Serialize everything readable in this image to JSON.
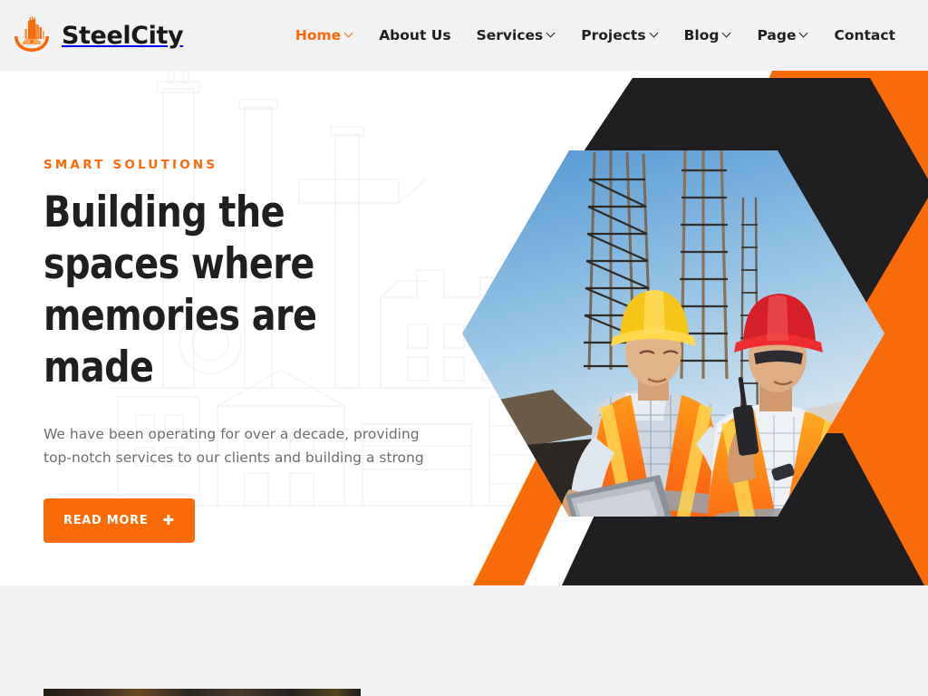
{
  "brand": {
    "name": "SteelCity",
    "logo_icon": "factory-skyline-icon",
    "accent_color": "#f96a09"
  },
  "nav": {
    "items": [
      {
        "label": "Home",
        "has_dropdown": true,
        "active": true,
        "icon": "chevron-down-icon"
      },
      {
        "label": "About Us",
        "has_dropdown": false,
        "active": false,
        "icon": ""
      },
      {
        "label": "Services",
        "has_dropdown": true,
        "active": false,
        "icon": "chevron-down-icon"
      },
      {
        "label": "Projects",
        "has_dropdown": true,
        "active": false,
        "icon": "chevron-down-icon"
      },
      {
        "label": "Blog",
        "has_dropdown": true,
        "active": false,
        "icon": "chevron-down-icon"
      },
      {
        "label": "Page",
        "has_dropdown": true,
        "active": false,
        "icon": "chevron-down-icon"
      },
      {
        "label": "Contact",
        "has_dropdown": false,
        "active": false,
        "icon": ""
      }
    ]
  },
  "hero": {
    "eyebrow": "SMART SOLUTIONS",
    "title": "Building the spaces where memories are made",
    "paragraph": "We have been operating for over a decade, providing top-notch services to our clients and building a strong",
    "cta_label": "READ MORE",
    "cta_icon": "plus-icon",
    "image_alt": "Two construction workers in high-visibility vests and hard hats reviewing a tablet on a building site",
    "colors": {
      "orange": "#f96a09",
      "dark": "#1f1f22",
      "background": "#ffffff",
      "header_background": "#f2f2f2",
      "body_text": "#6d6d72"
    },
    "watermark_icon": "industrial-plant-outline-watermark"
  },
  "next_section": {
    "thumbnail_alt": "dark construction project photograph"
  }
}
